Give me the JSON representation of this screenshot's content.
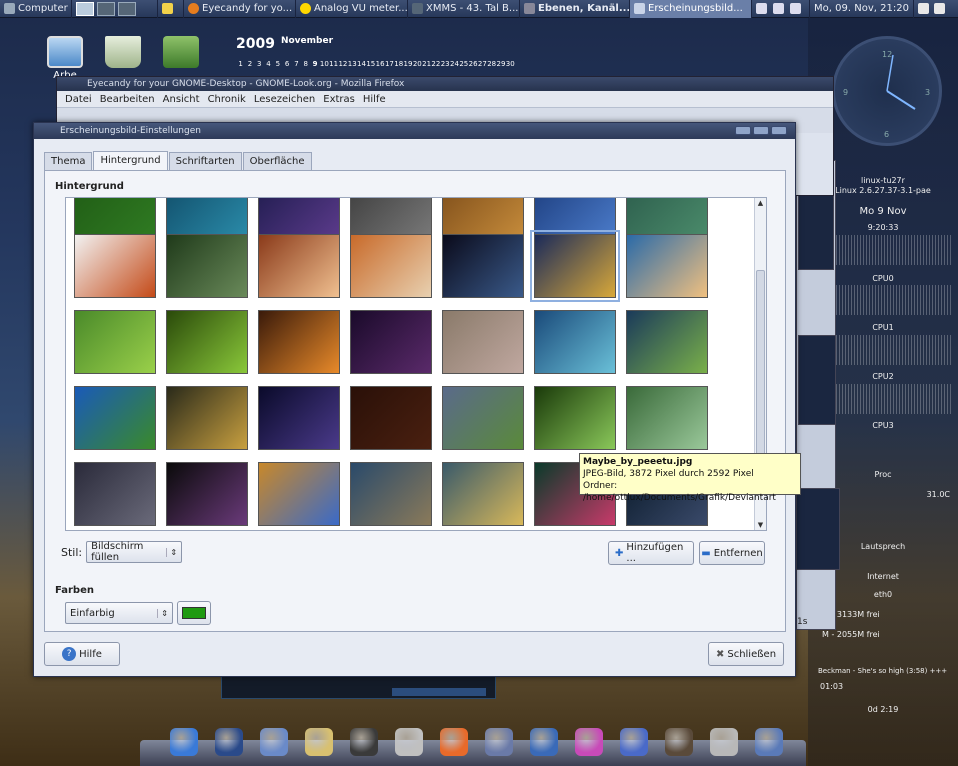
{
  "top_panel": {
    "computer": "Computer",
    "tasks": [
      {
        "label": "Eyecandy for yo..."
      },
      {
        "label": "Analog VU meter..."
      },
      {
        "label": "XMMS - 43. Tal B..."
      },
      {
        "label": "Ebenen, Kanäl..."
      },
      {
        "label": "Erscheinungsbild..."
      }
    ],
    "clock": "Mo, 09. Nov, 21:20"
  },
  "desktop_icons": [
    {
      "label": "Arbe"
    }
  ],
  "calendar": {
    "year": "2009",
    "month": "November",
    "days": [
      "1",
      "2",
      "3",
      "4",
      "5",
      "6",
      "7",
      "8",
      "9",
      "10",
      "11",
      "12",
      "13",
      "14",
      "15",
      "16",
      "17",
      "18",
      "19",
      "20",
      "21",
      "22",
      "23",
      "24",
      "25",
      "26",
      "27",
      "28",
      "29",
      "30"
    ],
    "today": "9"
  },
  "conky": {
    "host": "linux-tu27r",
    "kernel": "Linux 2.6.27.37-3.1-pae",
    "date": "Mo  9 Nov",
    "time": "9:20:33",
    "cpu_labels": [
      "CPU0",
      "CPU1",
      "CPU2",
      "CPU3"
    ],
    "proc": "Proc",
    "temp": "31.0C",
    "net_iface": "eth0",
    "disk1": "M - 3133M frei",
    "disk2": "M - 2055M frei",
    "music": "Beckman - She's so high (3:58) +++",
    "music_pos": "01:03",
    "music_len": "0d 2:19",
    "speaker_label": "Lautsprech",
    "internet": "Internet"
  },
  "firefox": {
    "title": "Eyecandy for your GNOME-Desktop - GNOME-Look.org - Mozilla Firefox",
    "menu": [
      "Datei",
      "Bearbeiten",
      "Ansicht",
      "Chronik",
      "Lesezeichen",
      "Extras",
      "Hilfe"
    ]
  },
  "dialog": {
    "title": "Erscheinungsbild-Einstellungen",
    "tabs": [
      "Thema",
      "Hintergrund",
      "Schriftarten",
      "Oberfläche"
    ],
    "selected_tab": "Hintergrund",
    "section_header": "Hintergrund",
    "style_label": "Stil:",
    "style_value": "Bildschirm füllen",
    "add_button": "Hinzufügen ...",
    "remove_button": "Entfernen",
    "colors_header": "Farben",
    "color_mode": "Einfarbig",
    "color_swatch": "#1f9a10",
    "help_button": "Hilfe",
    "close_button": "Schließen"
  },
  "tooltip": {
    "line1": "Maybe_by_peeetu.jpg",
    "line2": "JPEG-Bild, 3872 Pixel durch 2592 Pixel",
    "line3": "Ordner: /home/ottlux/Documents/Grafik/Deviantart"
  },
  "side_fragment": "1s"
}
